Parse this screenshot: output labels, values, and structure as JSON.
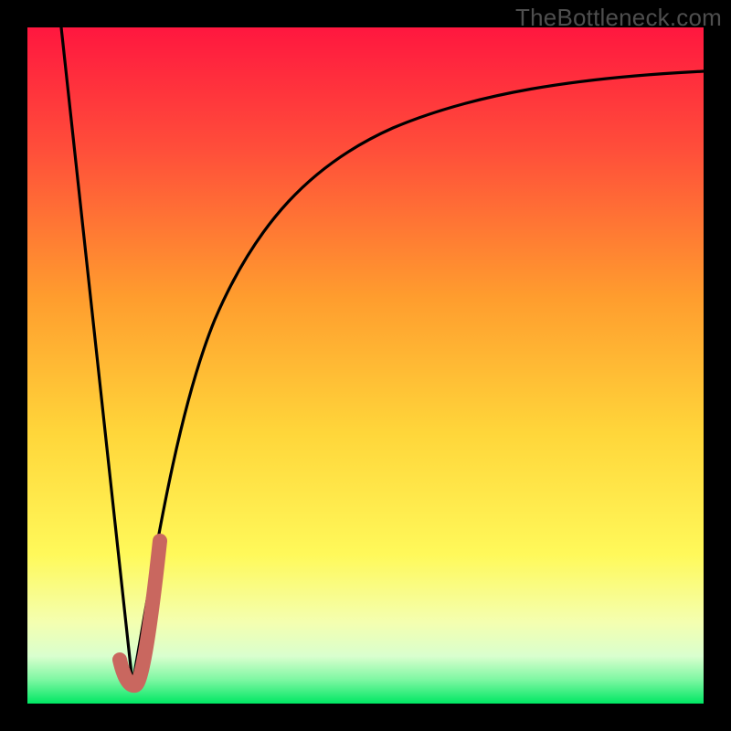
{
  "watermark": "TheBottleneck.com",
  "colors": {
    "bg_black": "#000000",
    "gradient_top": "#ff173f",
    "gradient_mid1": "#ff7b2b",
    "gradient_mid2": "#ffd63a",
    "gradient_mid3": "#fff95a",
    "gradient_bottom_pale": "#f1ffc7",
    "gradient_green": "#00e763",
    "curve": "#000000",
    "hook": "#c9675f"
  },
  "chart_data": {
    "type": "line",
    "title": "",
    "xlabel": "",
    "ylabel": "",
    "xlim": [
      0,
      100
    ],
    "ylim": [
      0,
      100
    ],
    "series": [
      {
        "name": "left-slope",
        "x": [
          5,
          15.5
        ],
        "values": [
          100,
          3
        ]
      },
      {
        "name": "right-curve",
        "x": [
          15.5,
          20,
          25,
          30,
          35,
          40,
          50,
          60,
          70,
          80,
          90,
          100
        ],
        "values": [
          3,
          27,
          48,
          60,
          68,
          74,
          81,
          85,
          88,
          90,
          91.5,
          92.5
        ]
      },
      {
        "name": "hook-overlay",
        "x": [
          13.6,
          15.5,
          19.5
        ],
        "values": [
          6.5,
          3,
          24
        ]
      }
    ]
  }
}
